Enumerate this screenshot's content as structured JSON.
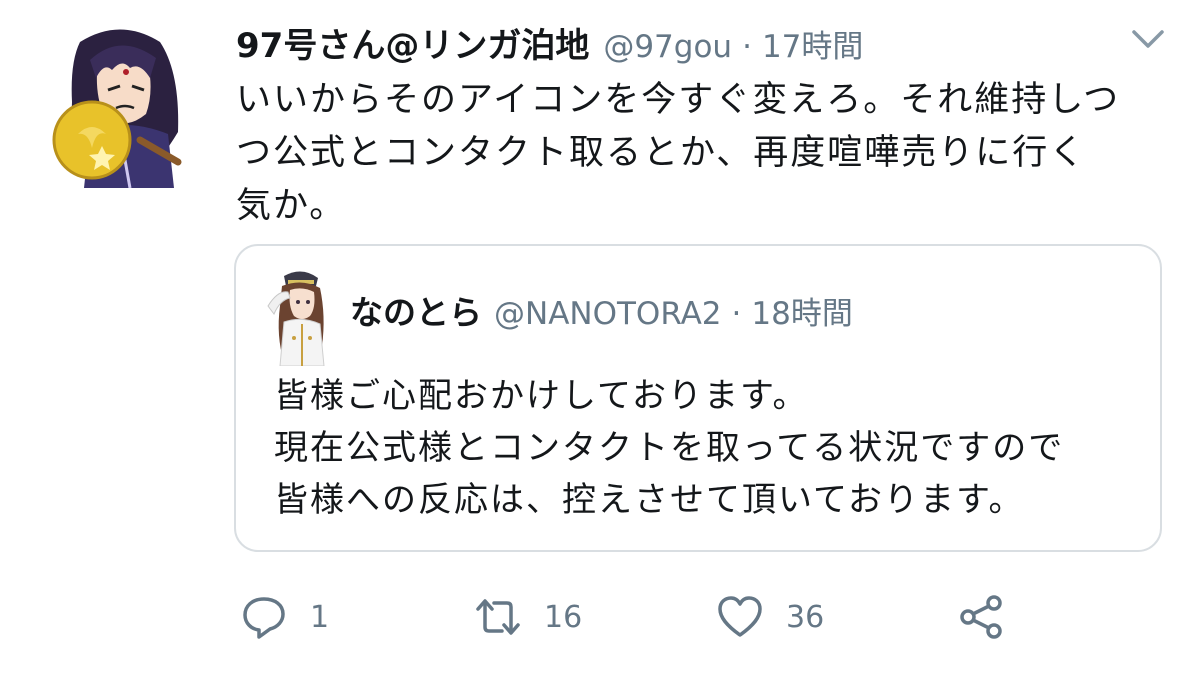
{
  "tweet": {
    "author": {
      "display_name": "97号さん@リンガ泊地",
      "handle": "@97gou",
      "separator": "·",
      "time": "17時間"
    },
    "body_lines": [
      "いいからそのアイコンを今すぐ変えろ。それ維持しつ",
      "つ公式とコンタクト取るとか、再度喧嘩売りに行く",
      "気か。"
    ]
  },
  "quoted": {
    "author": {
      "display_name": "なのとら",
      "handle": "@NANOTORA2",
      "separator": "·",
      "time": "18時間"
    },
    "body_lines": [
      "皆様ご心配おかけしております。",
      "現在公式様とコンタクトを取ってる状況ですので",
      "皆様への反応は、控えさせて頂いております。"
    ]
  },
  "actions": {
    "reply_count": "1",
    "retweet_count": "16",
    "like_count": "36"
  },
  "colors": {
    "text": "#14171a",
    "muted": "#657786",
    "border": "#d9dee2"
  },
  "icons": {
    "reply": "reply-icon",
    "retweet": "retweet-icon",
    "like": "heart-icon",
    "share": "share-icon",
    "menu": "chevron-down-icon"
  }
}
